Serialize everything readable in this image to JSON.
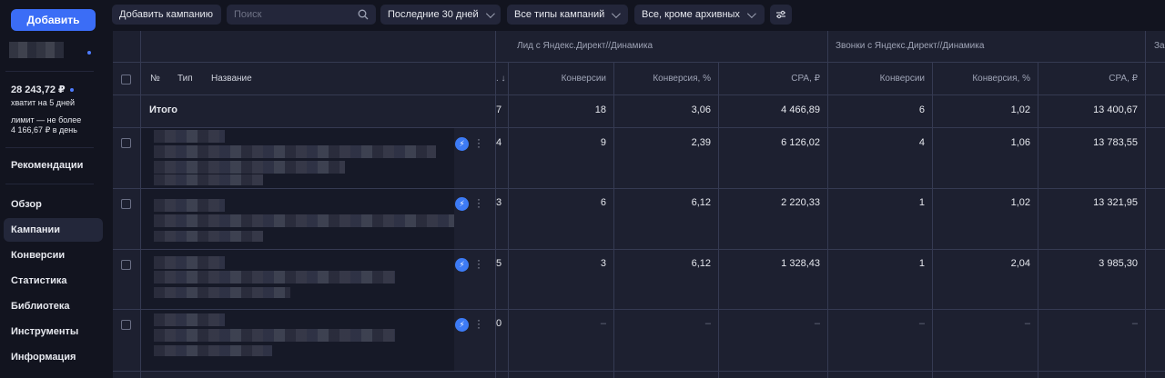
{
  "sidebar": {
    "add_button": "Добавить",
    "balance": "28 243,72 ₽",
    "balance_note": "хватит на 5 дней",
    "limit_line1": "лимит — не более",
    "limit_line2": "4 166,67 ₽ в день",
    "recommendations": "Рекомендации",
    "nav": [
      "Обзор",
      "Кампании",
      "Конверсии",
      "Статистика",
      "Библиотека",
      "Инструменты",
      "Информация"
    ],
    "active_item": "Кампании"
  },
  "toolbar": {
    "add_campaign": "Добавить кампанию",
    "search_placeholder": "Поиск",
    "period": "Последние 30 дней",
    "campaign_types": "Все типы кампаний",
    "archive_filter": "Все, кроме архивных"
  },
  "table": {
    "col_num": "№",
    "col_type": "Тип",
    "col_name": "Название",
    "groups": [
      "Лид с Яндекс.Директ//Динамика",
      "Звонки с Яндекс.Директ//Динамика",
      "За"
    ],
    "metric_headers": [
      "Конверсии",
      "Конверсия, %",
      "CPA, ₽"
    ],
    "sort_fragment": ". ↓",
    "total_label": "Итого",
    "total": {
      "frag": "7",
      "g1": [
        "18",
        "3,06",
        "4 466,89"
      ],
      "g2": [
        "6",
        "1,02",
        "13 400,67"
      ]
    },
    "rows": [
      {
        "frag": "4",
        "g1": [
          "9",
          "2,39",
          "6 126,02"
        ],
        "g2": [
          "4",
          "1,06",
          "13 783,55"
        ]
      },
      {
        "frag": "3",
        "g1": [
          "6",
          "6,12",
          "2 220,33"
        ],
        "g2": [
          "1",
          "1,02",
          "13 321,95"
        ]
      },
      {
        "frag": "5",
        "g1": [
          "3",
          "6,12",
          "1 328,43"
        ],
        "g2": [
          "1",
          "2,04",
          "3 985,30"
        ]
      },
      {
        "frag": "0",
        "g1": [
          "–",
          "–",
          "–"
        ],
        "g2": [
          "–",
          "–",
          "–"
        ]
      }
    ]
  }
}
